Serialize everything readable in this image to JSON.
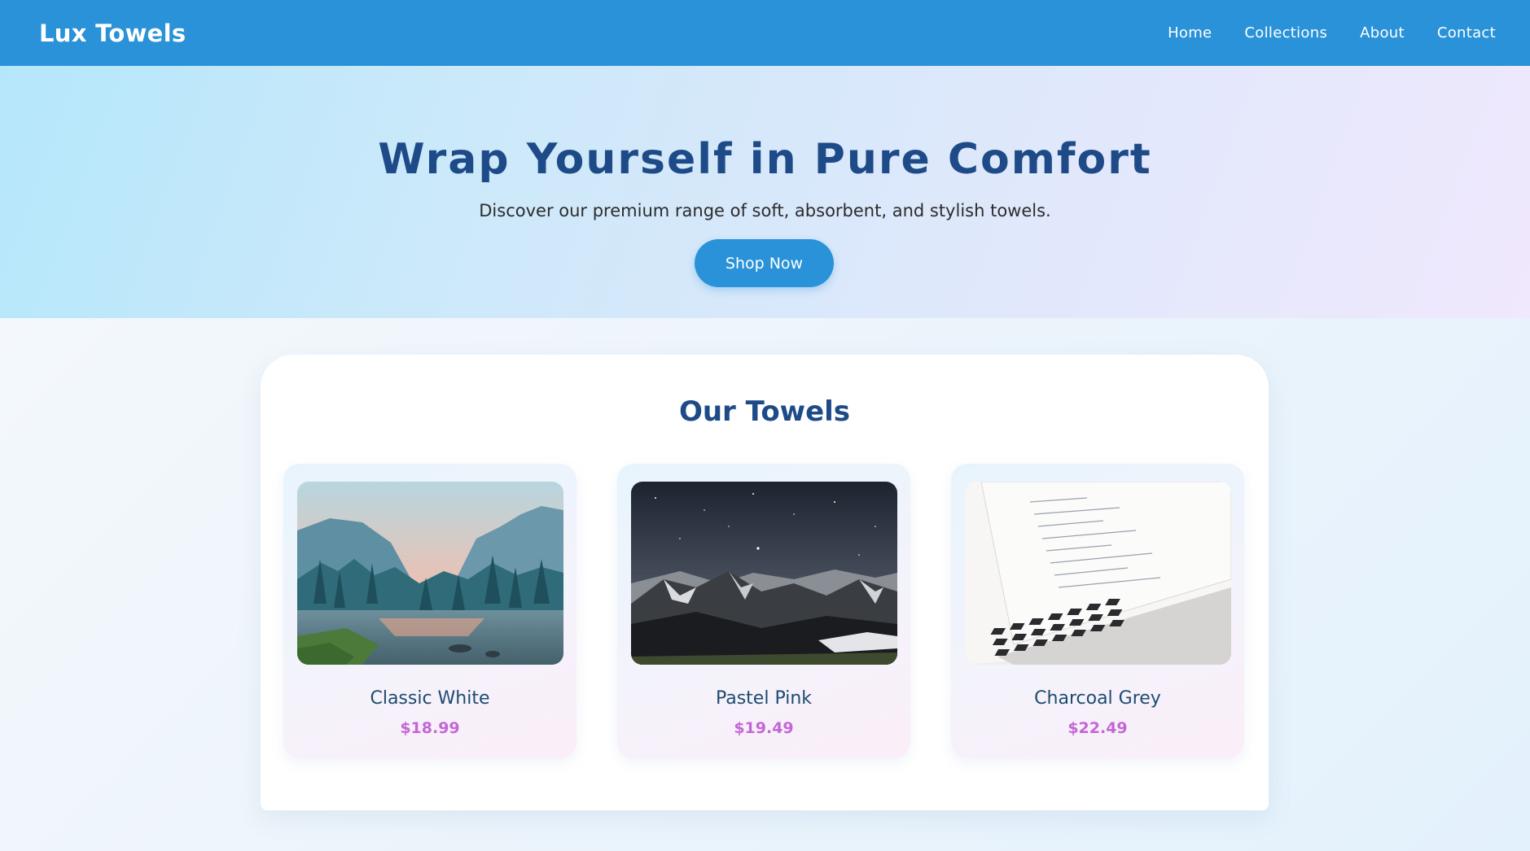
{
  "header": {
    "brand": "Lux Towels",
    "nav": [
      "Home",
      "Collections",
      "About",
      "Contact"
    ],
    "color": "#2a92d8"
  },
  "hero": {
    "title": "Wrap Yourself in Pure Comfort",
    "subtitle": "Discover our premium range of soft, absorbent, and stylish towels.",
    "cta_label": "Shop Now"
  },
  "products": {
    "heading": "Our Towels",
    "items": [
      {
        "name": "Classic White",
        "price": "$18.99",
        "image": "mountain-lake-photo"
      },
      {
        "name": "Pastel Pink",
        "price": "$19.49",
        "image": "night-sky-mountains-photo"
      },
      {
        "name": "Charcoal Grey",
        "price": "$22.49",
        "image": "laptop-code-photo"
      }
    ]
  },
  "colors": {
    "title": "#1e4b88",
    "price": "#c367d6"
  }
}
